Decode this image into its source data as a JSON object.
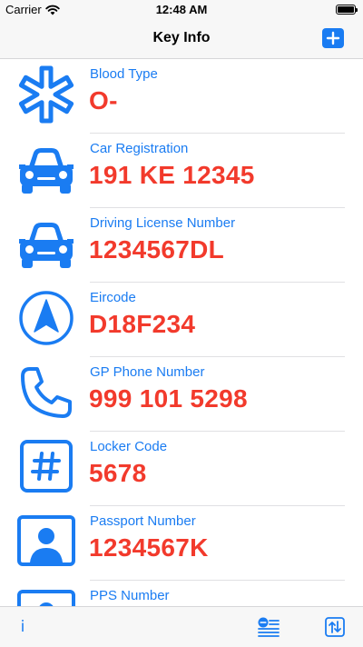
{
  "status": {
    "carrier": "Carrier",
    "time": "12:48 AM"
  },
  "nav": {
    "title": "Key Info",
    "add_icon": "plus-icon"
  },
  "colors": {
    "accent": "#1a7cf2",
    "value": "#f23a2c"
  },
  "items": [
    {
      "label": "Blood Type",
      "value": "O-",
      "icon": "medical-star-icon"
    },
    {
      "label": "Car Registration",
      "value": "191 KE 12345",
      "icon": "car-icon"
    },
    {
      "label": "Driving License Number",
      "value": "1234567DL",
      "icon": "car-icon"
    },
    {
      "label": "Eircode",
      "value": "D18F234",
      "icon": "location-arrow-icon"
    },
    {
      "label": "GP Phone Number",
      "value": "999 101 5298",
      "icon": "phone-icon"
    },
    {
      "label": "Locker Code",
      "value": "5678",
      "icon": "hash-icon"
    },
    {
      "label": "Passport Number",
      "value": "1234567K",
      "icon": "person-card-icon"
    },
    {
      "label": "PPS Number",
      "value": "",
      "icon": "person-card-icon"
    }
  ],
  "toolbar": {
    "info": "i",
    "list_icon": "list-icon",
    "sort_icon": "sort-icon"
  }
}
